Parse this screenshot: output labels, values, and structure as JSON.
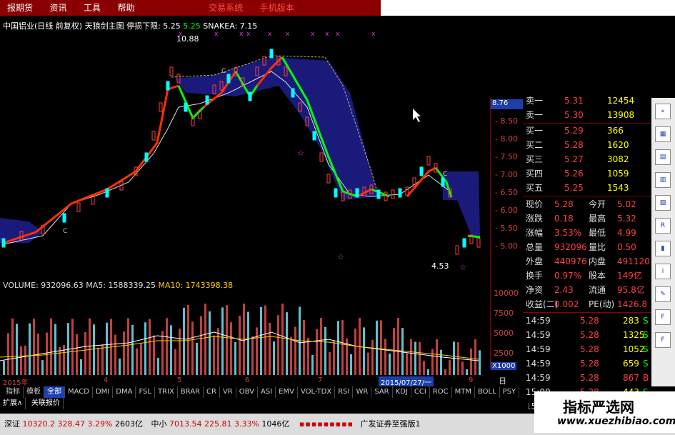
{
  "menu": [
    "报期货",
    "资讯",
    "工具",
    "帮助"
  ],
  "menu_red": [
    "交易系统",
    "手机版本"
  ],
  "header": {
    "title": "中国铝业(日线 前复权) 天狼剑主图",
    "stop_label": "停损下限:",
    "stop_value": "5.25",
    "mark1": "5.25",
    "snake": "SNAKEA: 7.15"
  },
  "annotations": {
    "high": "10.88",
    "low": "4.53",
    "c1": "C",
    "c2": "C",
    "c3": "C"
  },
  "price_axis": {
    "top": "8.76",
    "ticks": [
      "8.50",
      "8.00",
      "7.50",
      "7.00",
      "6.50",
      "6.00",
      "5.50",
      "5.00"
    ],
    "vol_ticks": [
      "10000",
      "7500",
      "5000",
      "2500"
    ],
    "vol_unit": "X1000"
  },
  "volume_header": {
    "v": "VOLUME: 932096.63",
    "ma5": "MA5: 1588339.25",
    "ma10": "MA10: 1743398.38"
  },
  "quote": {
    "sells": [
      [
        "卖一",
        "5.31",
        "12454"
      ],
      [
        "卖一",
        "5.30",
        "13908"
      ]
    ],
    "buys": [
      [
        "买一",
        "5.29",
        "366"
      ],
      [
        "买二",
        "5.28",
        "1620"
      ],
      [
        "买三",
        "5.27",
        "3082"
      ],
      [
        "买四",
        "5.26",
        "1059"
      ],
      [
        "买五",
        "5.25",
        "1543"
      ]
    ],
    "stats": [
      [
        "现价",
        "5.28",
        "今开",
        "5.02"
      ],
      [
        "涨跌",
        "0.18",
        "最高",
        "5.32"
      ],
      [
        "涨幅",
        "3.53%",
        "最低",
        "4.99"
      ],
      [
        "总量",
        "932096",
        "量比",
        "0.50"
      ],
      [
        "外盘",
        "440976",
        "内盘",
        "491120"
      ],
      [
        "换手",
        "0.97%",
        "股本",
        "149亿"
      ],
      [
        "净资",
        "2.43",
        "流通",
        "95.8亿"
      ],
      [
        "收益(二)",
        "0.002",
        "PE(动)",
        "1426.8"
      ]
    ],
    "ticks": [
      [
        "14:59",
        "5.28",
        "283",
        "S"
      ],
      [
        "14:59",
        "5.28",
        "1325",
        "S"
      ],
      [
        "14:59",
        "5.28",
        "1052",
        "S"
      ],
      [
        "14:59",
        "5.28",
        "659",
        "S"
      ],
      [
        "14:59",
        "5.28",
        "867",
        "B"
      ],
      [
        "15:00",
        "5.28",
        "443",
        "S"
      ],
      [
        "15:00",
        "5.28",
        "",
        "S"
      ]
    ]
  },
  "dates": {
    "year": "2015年",
    "m4": "4",
    "m5": "5",
    "m6": "6",
    "m7": "7",
    "sel": "2015/07/27/一",
    "m9": "9",
    "period": "日线"
  },
  "tabs": [
    "指标",
    "模板",
    "全部",
    "MACD",
    "DMI",
    "DMA",
    "FSL",
    "TRIX",
    "BRAR",
    "CR",
    "VR",
    "OBV",
    "ASI",
    "EMV",
    "VOL-TDX",
    "RSI",
    "WR",
    "SAR",
    "KDJ",
    "CCI",
    "ROC",
    "MTM",
    "BOLL",
    "PSY",
    "MCST"
  ],
  "sub_tabs": [
    "扩展∧",
    "关联报价"
  ],
  "status": {
    "sz_label": "深证",
    "sz_val": "10320.2",
    "sz_chg": "328.47",
    "sz_pct": "3.29%",
    "sz_amt": "2603亿",
    "zx_label": "中小",
    "zx_val": "7013.54",
    "zx_chg": "225.81",
    "zx_pct": "3.33%",
    "zx_amt": "1046亿",
    "broker": "广发证券至强版1"
  },
  "watermark": {
    "cn": "指标严选网",
    "url": "www.xuezhibiao.com"
  },
  "colors": {
    "up": "#ff4040",
    "down": "#00ffff",
    "ma_red": "#ff3000",
    "ma_green": "#00ff00",
    "cloud": "#1a1a7a"
  }
}
